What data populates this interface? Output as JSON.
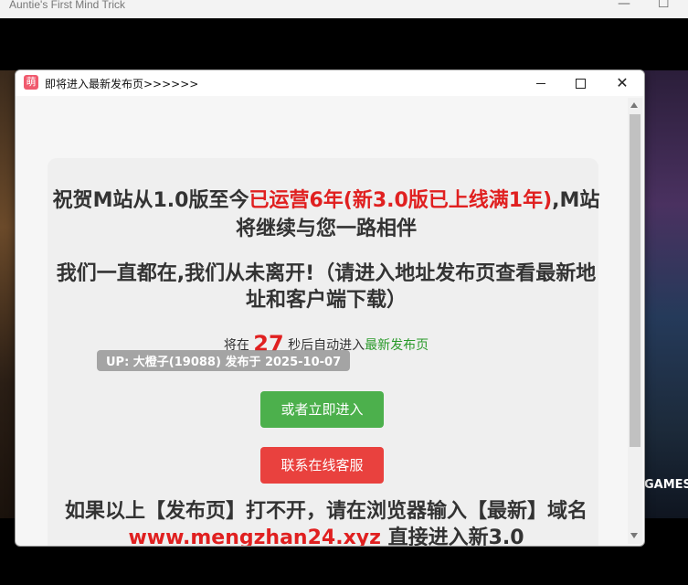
{
  "outer_window": {
    "title": "Auntie's First Mind Trick",
    "min_glyph": "—",
    "max_glyph": "☐"
  },
  "dialog": {
    "title": "即将进入最新发布页>>>>>>",
    "icon_glyph": "萌"
  },
  "content": {
    "headline_part1": "祝贺M站从1.0版至今",
    "headline_red": "已运营6年(新3.0版已上线满1年)",
    "headline_part2": ",M站将继续与您一路相伴",
    "subheadline": "我们一直都在,我们从未离开!（请进入地址发布页查看最新地址和客户端下载）",
    "countdown_prefix": "将在",
    "countdown_value": "27",
    "countdown_suffix": "秒后自动进入",
    "countdown_link": "最新发布页",
    "badge": "UP: 大橙子(19088) 发布于 2025-10-07",
    "enter_button": "或者立即进入",
    "service_button": "联系在线客服",
    "footer_prefix": "如果以上【发布页】打不开，请在浏览器输入【最新】域名 ",
    "footer_url": "www.mengzhan24.xyz",
    "footer_suffix": " 直接进入新3.0"
  },
  "background": {
    "game_label": "GAMES"
  },
  "colors": {
    "accent_red": "#e02020",
    "link_green": "#2a9a2a",
    "enter_green": "#4cb04c",
    "service_red": "#e9413e"
  }
}
